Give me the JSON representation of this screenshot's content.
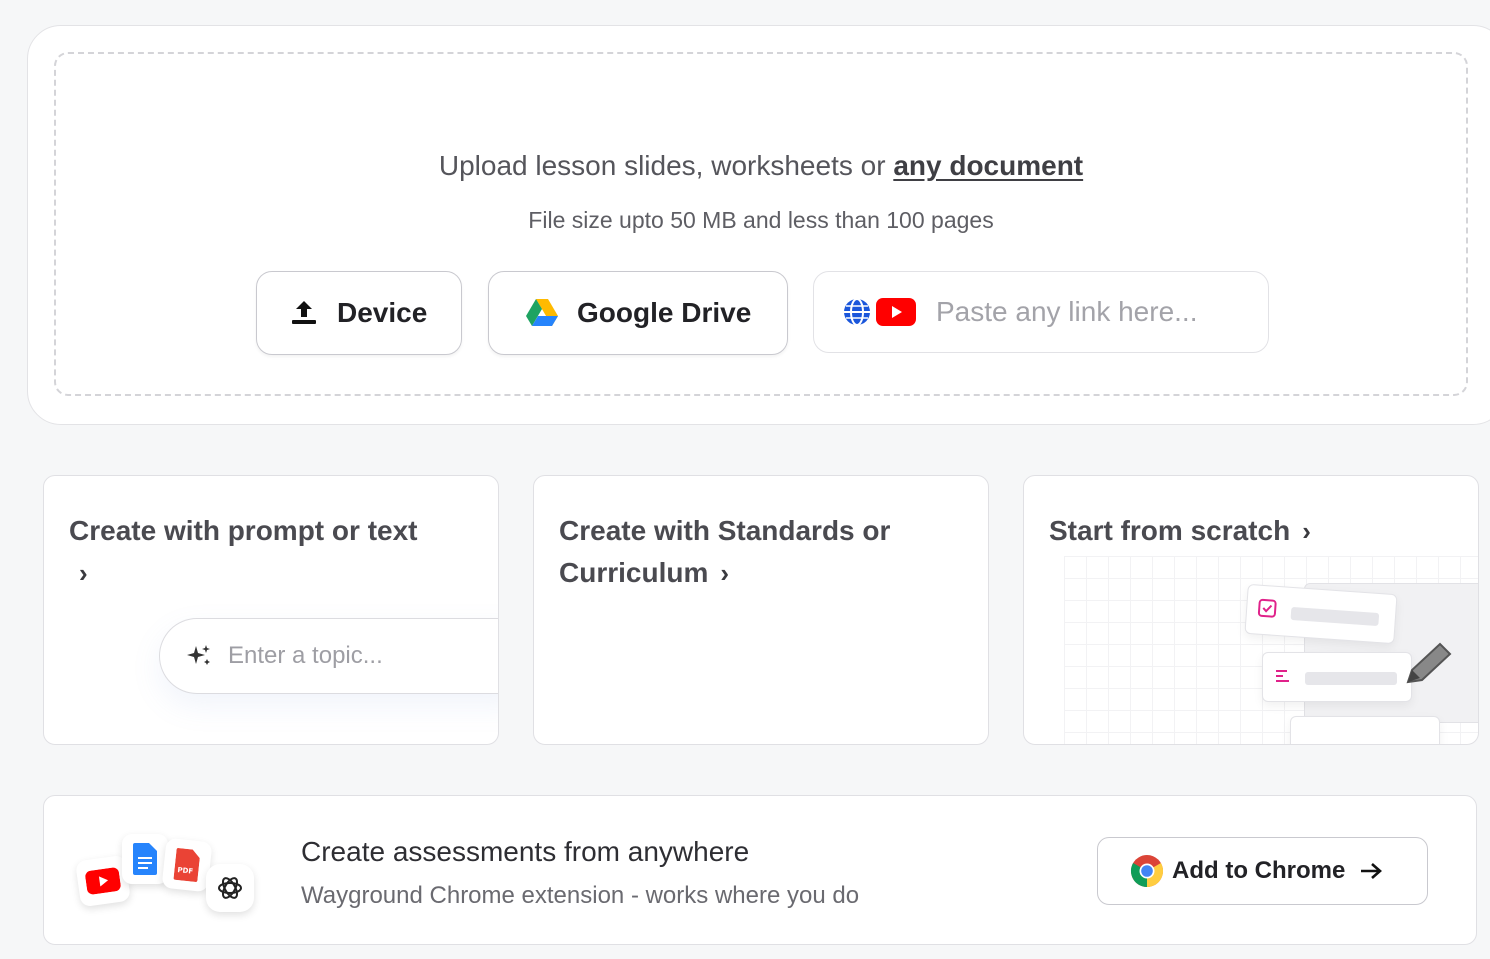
{
  "upload": {
    "title_prefix": "Upload lesson slides, worksheets or ",
    "title_link": "any document",
    "subtitle": "File size upto 50 MB and less than 100 pages",
    "device_label": "Device",
    "drive_label": "Google Drive",
    "link_placeholder": "Paste any link here..."
  },
  "options": {
    "prompt": {
      "title": "Create with prompt or text",
      "chevron": "›",
      "input_placeholder": "Enter a topic..."
    },
    "standards": {
      "title": "Create with Standards or Curriculum",
      "chevron": "›"
    },
    "scratch": {
      "title": "Start from scratch",
      "chevron": "›"
    }
  },
  "chrome_promo": {
    "title": "Create assessments from anywhere",
    "subtitle": "Wayground Chrome extension - works where you do",
    "button_label": "Add to Chrome"
  },
  "colors": {
    "youtube": "#ff0000",
    "drive_green": "#1ea362",
    "drive_yellow": "#ffba00",
    "drive_blue": "#2684fc",
    "accent_pink": "#e0228a"
  }
}
